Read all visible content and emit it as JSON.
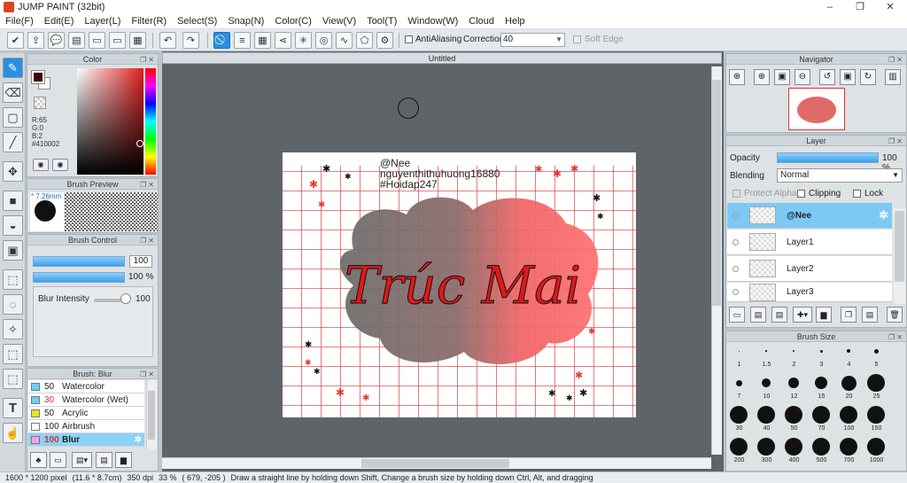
{
  "window": {
    "title": "JUMP PAINT (32bit)",
    "minimize": "–",
    "maximize": "❐",
    "close": "✕"
  },
  "menu": [
    "File(F)",
    "Edit(E)",
    "Layer(L)",
    "Filter(R)",
    "Select(S)",
    "Snap(N)",
    "Color(C)",
    "View(V)",
    "Tool(T)",
    "Window(W)",
    "Cloud",
    "Help"
  ],
  "toolbar": {
    "buttons": [
      {
        "icon": "cloud-check-icon",
        "glyph": "✔"
      },
      {
        "icon": "export-icon",
        "glyph": "⇪"
      },
      {
        "icon": "speech-bubble-icon",
        "glyph": "💬"
      },
      {
        "icon": "comment-icon",
        "glyph": "▤"
      },
      {
        "icon": "page-icon",
        "glyph": "▭"
      },
      {
        "icon": "page-alt-icon",
        "glyph": "▭"
      },
      {
        "icon": "grid-tool-icon",
        "glyph": "▦"
      },
      {
        "icon": "undo-icon",
        "glyph": "↶"
      },
      {
        "icon": "redo-icon",
        "glyph": "↷"
      },
      {
        "icon": "no-snap-icon",
        "glyph": "⃠"
      },
      {
        "icon": "parallel-snap-icon",
        "glyph": "≡"
      },
      {
        "icon": "grid-snap-icon",
        "glyph": "▦"
      },
      {
        "icon": "perspective-snap-icon",
        "glyph": "⋖"
      },
      {
        "icon": "radial-snap-icon",
        "glyph": "✳"
      },
      {
        "icon": "concentric-snap-icon",
        "glyph": "◎"
      },
      {
        "icon": "curve-snap-icon",
        "glyph": "∿"
      },
      {
        "icon": "polygon-snap-icon",
        "glyph": "⬠"
      },
      {
        "icon": "snap-settings-icon",
        "glyph": "⚙"
      }
    ],
    "antialiasing_label": "AntiAliasing",
    "correction_label": "Correction",
    "correction_value": "40",
    "soft_edge_label": "Soft Edge"
  },
  "tools": [
    {
      "icon": "pen-icon",
      "glyph": "✎"
    },
    {
      "icon": "eraser-icon",
      "glyph": "⌫"
    },
    {
      "icon": "rect-select-icon",
      "glyph": "▢"
    },
    {
      "icon": "line-icon",
      "glyph": "╱"
    },
    {
      "icon": "move-icon",
      "glyph": "✥"
    },
    {
      "icon": "fill-rect-icon",
      "glyph": "■"
    },
    {
      "icon": "bucket-icon",
      "glyph": "◒"
    },
    {
      "icon": "gradient-icon",
      "glyph": "▣"
    },
    {
      "icon": "select-icon",
      "glyph": "⬚"
    },
    {
      "icon": "lasso-icon",
      "glyph": "◌"
    },
    {
      "icon": "magic-wand-icon",
      "glyph": "✧"
    },
    {
      "icon": "select-pen-icon",
      "glyph": "⬚"
    },
    {
      "icon": "select-eraser-icon",
      "glyph": "⬚"
    },
    {
      "icon": "text-icon",
      "glyph": "T"
    },
    {
      "icon": "hand-icon",
      "glyph": "☝"
    }
  ],
  "color": {
    "title": "Color",
    "r": "R:65",
    "g": "G:0",
    "b": "B:2",
    "hex": "#410002",
    "foreground": "#410002",
    "background": "#ffffff"
  },
  "brush_preview": {
    "title": "Brush Preview",
    "size": "* 7.26mm"
  },
  "brush_control": {
    "title": "Brush Control",
    "size_value": "100",
    "opacity_value": "100 %",
    "blur_label": "Blur Intensity",
    "blur_value": "100"
  },
  "brush_list": {
    "title": "Brush: Blur",
    "items": [
      {
        "num": "50",
        "name": "Watercolor",
        "color": "#6ad2f5"
      },
      {
        "num": "30",
        "name": "Watercolor (Wet)",
        "color": "#6ad2f5"
      },
      {
        "num": "50",
        "name": "Acrylic",
        "color": "#f0e020"
      },
      {
        "num": "100",
        "name": "Airbrush",
        "color": "#ffffff"
      },
      {
        "num": "100",
        "name": "Blur",
        "color": "#f4a0e8"
      }
    ]
  },
  "document": {
    "tab": "Untitled"
  },
  "artwork": {
    "watermark_line1": "@Nee",
    "watermark_line2": "nguyenthithuhuong16880",
    "watermark_line3": "#Hoidap247",
    "script_text": "Trúc Mai"
  },
  "navigator": {
    "title": "Navigator"
  },
  "layer": {
    "title": "Layer",
    "opacity_label": "Opacity",
    "opacity_value": "100 %",
    "blending_label": "Blending",
    "blending_value": "Normal",
    "protect_alpha": "Protect Alpha",
    "clipping": "Clipping",
    "lock": "Lock",
    "layers": [
      "@Nee",
      "Layer1",
      "Layer2",
      "Layer3"
    ]
  },
  "brush_size": {
    "title": "Brush Size",
    "sizes": [
      "1",
      "1.5",
      "2",
      "3",
      "4",
      "5",
      "7",
      "10",
      "12",
      "15",
      "20",
      "25",
      "30",
      "40",
      "50",
      "70",
      "100",
      "150",
      "200",
      "300",
      "400",
      "500",
      "700",
      "1000"
    ]
  },
  "status": {
    "dims": "1600 * 1200 pixel",
    "cm": "(11.6 * 8.7cm)",
    "dpi": "350 dpi",
    "zoom": "33 %",
    "coords": "( 679, -205 )",
    "hint": "Draw a straight line by holding down Shift, Change a brush size by holding down Ctrl, Alt, and dragging"
  }
}
